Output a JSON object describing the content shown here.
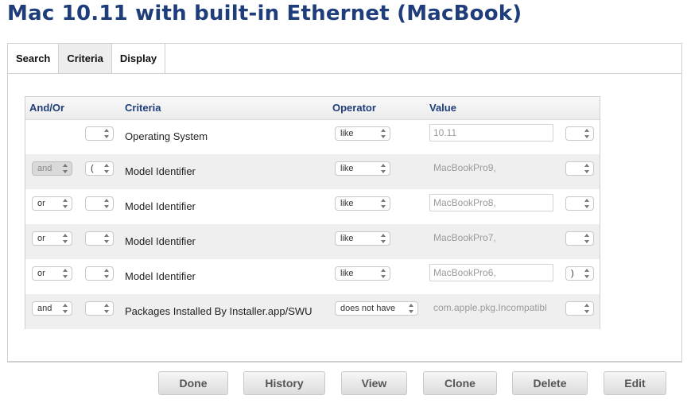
{
  "page": {
    "title": "Mac 10.11 with built-in Ethernet (MacBook)"
  },
  "tabs": [
    {
      "label": "Search",
      "active": false
    },
    {
      "label": "Criteria",
      "active": true
    },
    {
      "label": "Display",
      "active": false
    }
  ],
  "table": {
    "headers": {
      "and_or": "And/Or",
      "criteria": "Criteria",
      "operator": "Operator",
      "value": "Value"
    },
    "rows": [
      {
        "and_or": "",
        "open_paren": "",
        "criteria": "Operating System",
        "operator": "like",
        "value": "10.11",
        "close_paren": ""
      },
      {
        "and_or": "and",
        "open_paren": "(",
        "criteria": "Model Identifier",
        "operator": "like",
        "value": "MacBookPro9,",
        "close_paren": ""
      },
      {
        "and_or": "or",
        "open_paren": "",
        "criteria": "Model Identifier",
        "operator": "like",
        "value": "MacBookPro8,",
        "close_paren": ""
      },
      {
        "and_or": "or",
        "open_paren": "",
        "criteria": "Model Identifier",
        "operator": "like",
        "value": "MacBookPro7,",
        "close_paren": ""
      },
      {
        "and_or": "or",
        "open_paren": "",
        "criteria": "Model Identifier",
        "operator": "like",
        "value": "MacBookPro6,",
        "close_paren": ")"
      },
      {
        "and_or": "and",
        "open_paren": "",
        "criteria": "Packages Installed By Installer.app/SWU",
        "operator": "does not have",
        "value": "com.apple.pkg.Incompatibl",
        "close_paren": ""
      }
    ]
  },
  "buttons": {
    "done": "Done",
    "history": "History",
    "view": "View",
    "clone": "Clone",
    "delete": "Delete",
    "edit": "Edit"
  },
  "colors": {
    "title": "#1f3d7a",
    "header_text": "#1f3d7a",
    "row_shade": "#efefef"
  },
  "icons": {
    "select_arrows": "up-down-arrows-icon"
  }
}
